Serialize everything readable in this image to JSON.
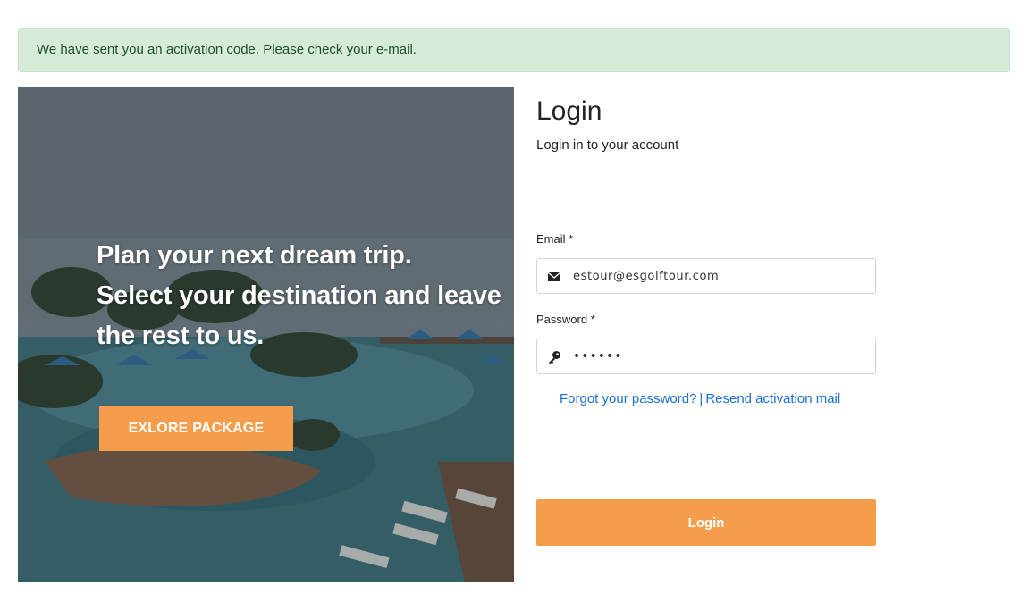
{
  "alert": {
    "message": "We have sent you an activation code. Please check your e-mail."
  },
  "hero": {
    "line1": "Plan your next dream trip.",
    "line2": "Select your destination and leave",
    "line3": "the rest to us.",
    "button_label": "EXLORE PACKAGE"
  },
  "login": {
    "title": "Login",
    "subtitle": "Login in to your account",
    "email_label": "Email *",
    "email_value": "estour@esgolftour.com",
    "email_icon": "envelope-icon",
    "password_label": "Password *",
    "password_value": "••••••",
    "password_icon": "key-icon",
    "forgot_link": "Forgot your password?",
    "link_separator": "|",
    "resend_link": "Resend activation mail",
    "submit_label": "Login"
  },
  "colors": {
    "accent": "#f59d4c",
    "link": "#1a6fd6",
    "alert_bg": "#d6ecd9",
    "alert_text": "#1f4d2a"
  }
}
